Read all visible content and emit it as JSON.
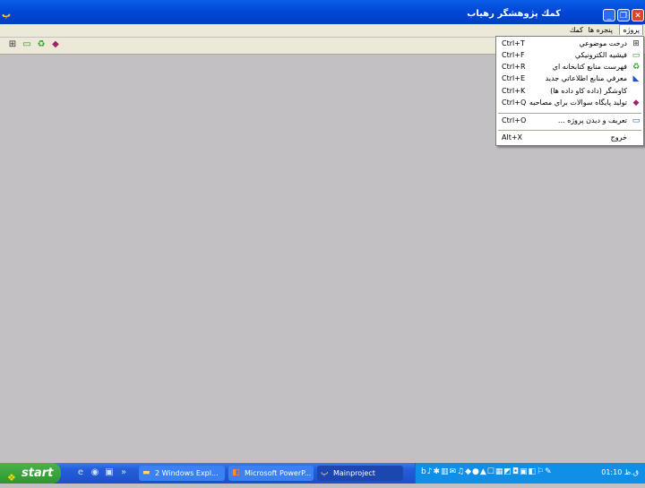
{
  "window": {
    "title": "كمك پژوهشگر رهياب",
    "app_icon": "پ",
    "controls": {
      "minimize": "_",
      "restore": "❐",
      "close": "✕"
    }
  },
  "menubar": {
    "items": [
      {
        "label": "پروژه",
        "active": true
      },
      {
        "label": "پنجره ها"
      },
      {
        "label": "كمك"
      }
    ]
  },
  "toolbar": {
    "buttons": [
      {
        "icon": "tree-icon",
        "glyph": "⊞"
      },
      {
        "icon": "document-icon",
        "glyph": "▭"
      },
      {
        "icon": "recycle-icon",
        "glyph": "♻"
      },
      {
        "icon": "book-icon",
        "glyph": "◆"
      }
    ]
  },
  "project_menu": {
    "items": [
      {
        "label": "درخت موضوعي",
        "shortcut": "Ctrl+T",
        "icon": "tree-icon",
        "glyph": "⊞"
      },
      {
        "label": "فيشيه الكترونيكي",
        "shortcut": "Ctrl+F",
        "icon": "document-icon",
        "glyph": "▭"
      },
      {
        "label": "فهرست منابع كتابخانه اي",
        "shortcut": "Ctrl+R",
        "icon": "recycle-icon",
        "glyph": "♻"
      },
      {
        "label": "معرفي منابع اطلاعاتي جديد",
        "shortcut": "Ctrl+E",
        "icon": "new-source-icon",
        "glyph": "◣"
      },
      {
        "label": "كاوشگر (داده كاو داده ها)",
        "shortcut": "Ctrl+K",
        "icon": "",
        "glyph": ""
      },
      {
        "label": "توليد پايگاه سوالات براي مصاحبه",
        "shortcut": "Ctrl+Q",
        "icon": "book-icon",
        "glyph": "◆"
      },
      {
        "label": "تعريف و ديدن پروژه ...",
        "shortcut": "Ctrl+O",
        "icon": "window-icon",
        "glyph": "▭"
      },
      {
        "label": "خروج",
        "shortcut": "Alt+X",
        "icon": "",
        "glyph": ""
      }
    ]
  },
  "taskbar": {
    "start_label": "start",
    "start_flag": "❖",
    "quick_launch": [
      "e",
      "◉",
      "▣",
      "»"
    ],
    "tasks": [
      {
        "label": "2 Windows Expl...",
        "glyph": "▬",
        "active": false
      },
      {
        "label": "Microsoft PowerP...",
        "glyph": "◧",
        "active": false
      },
      {
        "label": "Mainproject",
        "glyph": "پ",
        "active": true
      }
    ],
    "tray_icons": "b♪✱▥✉♫◆●▲☐▦◩◘▣◧⚐✎",
    "clock": "01:10 ق.ظ"
  }
}
